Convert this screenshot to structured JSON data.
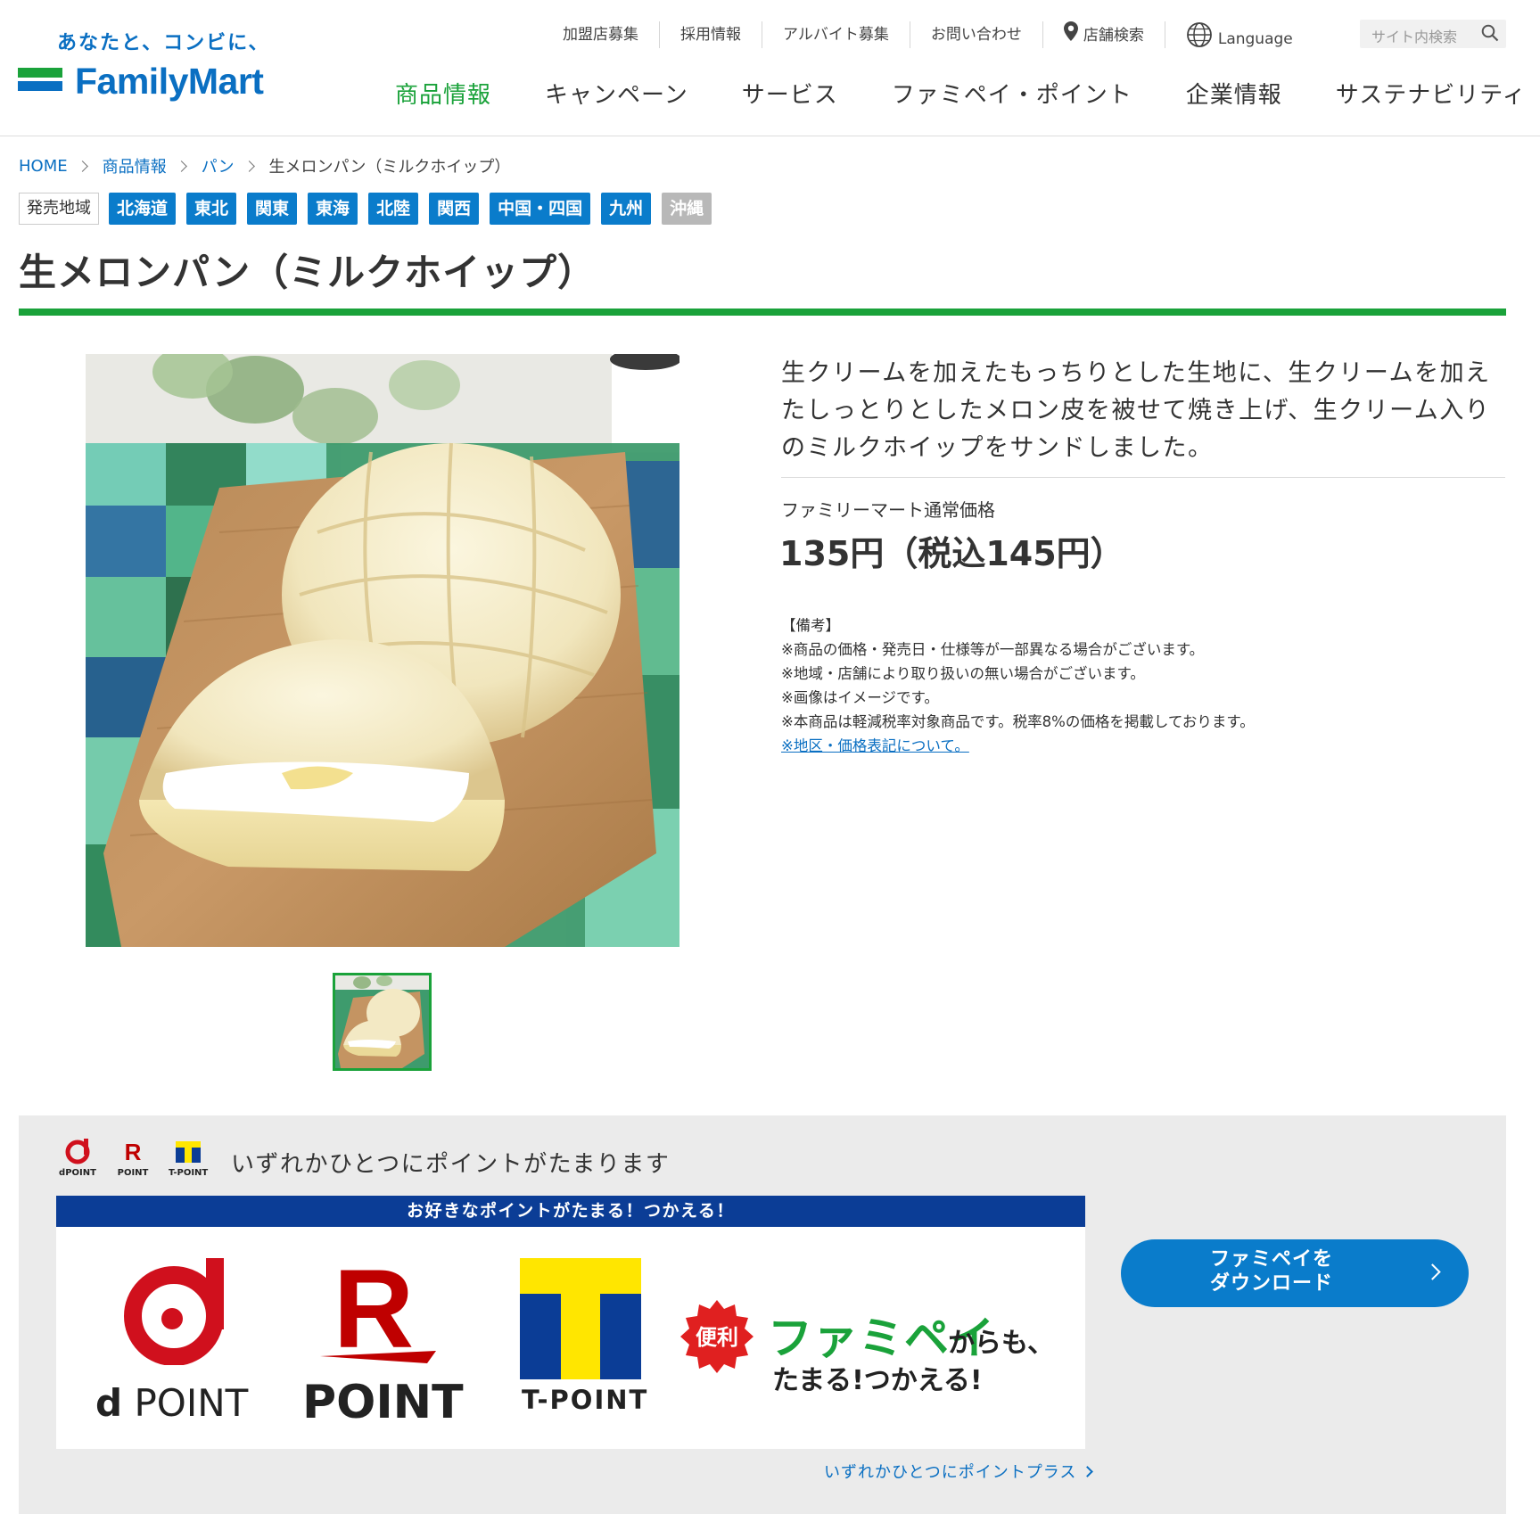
{
  "brand": {
    "tagline": "あなたと、コンビに、",
    "name": "FamilyMart",
    "colors": {
      "green": "#1aa23a",
      "blue": "#0a6fc2",
      "navy": "#0b3d96"
    }
  },
  "util_nav": {
    "items": [
      "加盟店募集",
      "採用情報",
      "アルバイト募集",
      "お問い合わせ"
    ],
    "store_search": "店舗検索",
    "language": "Language",
    "search_placeholder": "サイト内検索"
  },
  "main_nav": {
    "items": [
      "商品情報",
      "キャンペーン",
      "サービス",
      "ファミペイ・ポイント",
      "企業情報",
      "サステナビリティ"
    ],
    "active_index": 0
  },
  "breadcrumb": [
    "HOME",
    "商品情報",
    "パン",
    "生メロンパン（ミルクホイップ）"
  ],
  "regions": {
    "label": "発売地域",
    "available": [
      "北海道",
      "東北",
      "関東",
      "東海",
      "北陸",
      "関西",
      "中国・四国",
      "九州"
    ],
    "unavailable": [
      "沖縄"
    ]
  },
  "product": {
    "title": "生メロンパン（ミルクホイップ）",
    "description": "生クリームを加えたもっちりとした生地に、生クリームを加えたしっとりとしたメロン皮を被せて焼き上げ、生クリーム入りのミルクホイップをサンドしました。",
    "price_label": "ファミリーマート通常価格",
    "price": "135円（税込145円）",
    "notes_heading": "【備考】",
    "notes": [
      "※商品の価格・発売日・仕様等が一部異なる場合がございます。",
      "※地域・店舗により取り扱いの無い場合がございます。",
      "※画像はイメージです。",
      "※本商品は軽減税率対象商品です。税率8%の価格を掲載しております。"
    ],
    "notes_link": "※地区・価格表記について。"
  },
  "points": {
    "headline": "いずれかひとつにポイントがたまります",
    "mini_logos": [
      "dPOINT",
      "POINT",
      "T-POINT"
    ],
    "campaign_bar": "お好きなポイントがたまる！つかえる！",
    "badge": "便利",
    "famipay": "ファミペイ",
    "famipay_suffix": "からも、",
    "famipay_line2": "たまる!つかえる!",
    "big_logos": {
      "d_point": "POINT",
      "r_point": "POINT",
      "t_point": "T-POINT"
    },
    "download_button": "ファミペイを\nダウンロード",
    "link": "いずれかひとつにポイントプラス"
  }
}
